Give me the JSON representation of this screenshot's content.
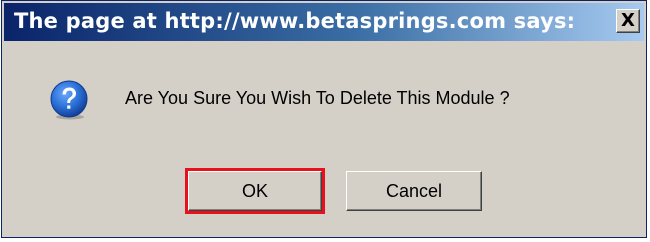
{
  "dialog": {
    "title": "The page at http://www.betasprings.com says:",
    "close_label": "X",
    "icon": "question-icon",
    "message": "Are You Sure You Wish To Delete This Module ?",
    "buttons": {
      "ok_label": "OK",
      "cancel_label": "Cancel"
    },
    "highlighted_button": "OK",
    "highlight_color": "#e8101c"
  },
  "colors": {
    "titlebar_start": "#0a246a",
    "titlebar_end": "#a6caf0",
    "face": "#d4d0c8",
    "icon_blue": "#2a6fd6"
  }
}
